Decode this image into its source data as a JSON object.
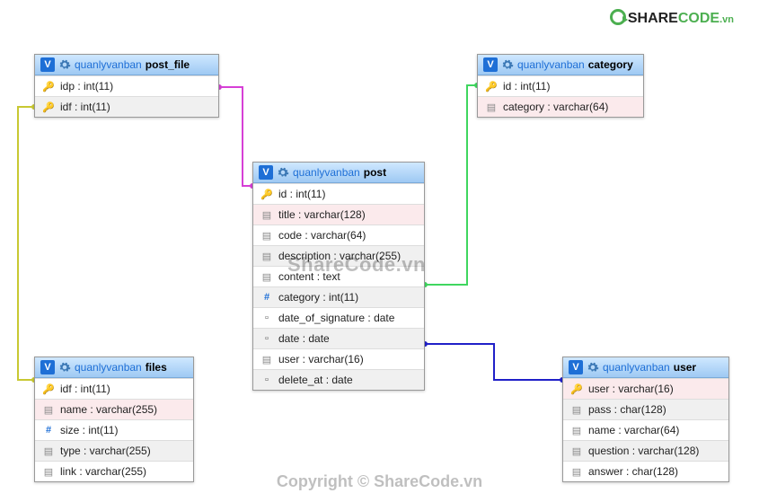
{
  "brand": {
    "dark": "SHARE",
    "green": "CODE",
    "vn": ".vn"
  },
  "watermark_center": "ShareCode.vn",
  "watermark_bottom": "Copyright © ShareCode.vn",
  "schema": "quanlyvanban",
  "tables": {
    "post_file": {
      "name": "post_file",
      "fields": [
        {
          "icon": "key",
          "text": "idp : int(11)",
          "bg": ""
        },
        {
          "icon": "key",
          "text": "idf : int(11)",
          "bg": "alt"
        }
      ]
    },
    "category": {
      "name": "category",
      "fields": [
        {
          "icon": "key",
          "text": "id : int(11)",
          "bg": ""
        },
        {
          "icon": "idx",
          "text": "category : varchar(64)",
          "bg": "pink"
        }
      ]
    },
    "post": {
      "name": "post",
      "fields": [
        {
          "icon": "key",
          "text": "id : int(11)",
          "bg": ""
        },
        {
          "icon": "idx",
          "text": "title : varchar(128)",
          "bg": "pink"
        },
        {
          "icon": "idx",
          "text": "code : varchar(64)",
          "bg": ""
        },
        {
          "icon": "idx",
          "text": "description : varchar(255)",
          "bg": "alt"
        },
        {
          "icon": "idx",
          "text": "content : text",
          "bg": ""
        },
        {
          "icon": "hash",
          "text": "category : int(11)",
          "bg": "alt"
        },
        {
          "icon": "cal",
          "text": "date_of_signature : date",
          "bg": ""
        },
        {
          "icon": "cal",
          "text": "date : date",
          "bg": "alt"
        },
        {
          "icon": "idx",
          "text": "user : varchar(16)",
          "bg": ""
        },
        {
          "icon": "cal",
          "text": "delete_at : date",
          "bg": "alt"
        }
      ]
    },
    "files": {
      "name": "files",
      "fields": [
        {
          "icon": "key",
          "text": "idf : int(11)",
          "bg": ""
        },
        {
          "icon": "idx",
          "text": "name : varchar(255)",
          "bg": "pink"
        },
        {
          "icon": "hash",
          "text": "size : int(11)",
          "bg": ""
        },
        {
          "icon": "idx",
          "text": "type : varchar(255)",
          "bg": "alt"
        },
        {
          "icon": "idx",
          "text": "link : varchar(255)",
          "bg": ""
        }
      ]
    },
    "user": {
      "name": "user",
      "fields": [
        {
          "icon": "key",
          "text": "user : varchar(16)",
          "bg": "pink"
        },
        {
          "icon": "idx",
          "text": "pass : char(128)",
          "bg": "alt"
        },
        {
          "icon": "idx",
          "text": "name : varchar(64)",
          "bg": ""
        },
        {
          "icon": "idx",
          "text": "question : varchar(128)",
          "bg": "alt"
        },
        {
          "icon": "idx",
          "text": "answer : char(128)",
          "bg": ""
        }
      ]
    }
  },
  "relations": [
    {
      "from": "post_file.idp",
      "to": "post.id",
      "color": "#d63fd6"
    },
    {
      "from": "post_file.idf",
      "to": "files.idf",
      "color": "#c8c832"
    },
    {
      "from": "post.category",
      "to": "category.id",
      "color": "#3fd65f"
    },
    {
      "from": "post.user",
      "to": "user.user",
      "color": "#2020c8"
    }
  ]
}
